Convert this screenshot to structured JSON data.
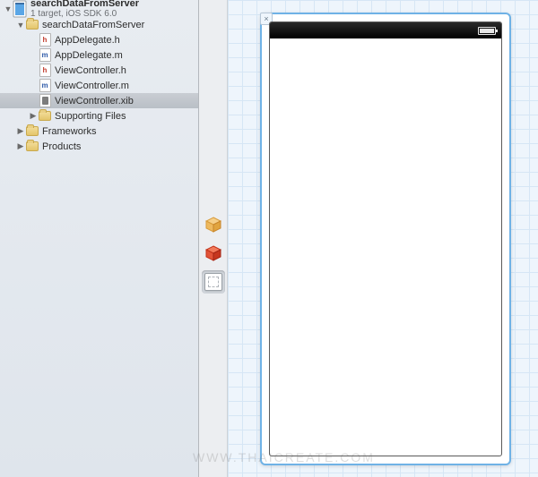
{
  "project": {
    "name": "searchDataFromServer",
    "subtitle": "1 target, iOS SDK 6.0"
  },
  "tree": {
    "root_folder": "searchDataFromServer",
    "files": {
      "appdelegate_h": "AppDelegate.h",
      "appdelegate_m": "AppDelegate.m",
      "viewcontroller_h": "ViewController.h",
      "viewcontroller_m": "ViewController.m",
      "viewcontroller_xib": "ViewController.xib"
    },
    "supporting": "Supporting Files",
    "frameworks": "Frameworks",
    "products": "Products"
  },
  "watermark": "WWW.THAICREATE.COM"
}
